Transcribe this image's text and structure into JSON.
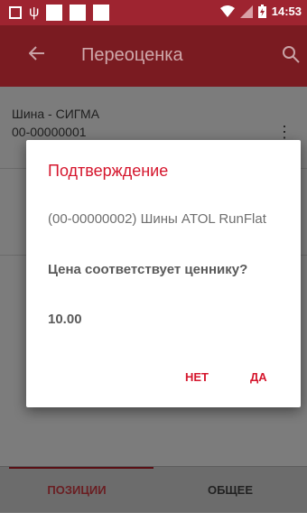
{
  "status_bar": {
    "time": "14:53"
  },
  "app_bar": {
    "title": "Переоценка"
  },
  "list": {
    "items": [
      {
        "name": "Шина - СИГМА",
        "code": "00-00000001"
      }
    ]
  },
  "bottom_nav": {
    "tab_positions": "ПОЗИЦИИ",
    "tab_general": "ОБЩЕЕ"
  },
  "dialog": {
    "title": "Подтверждение",
    "message": "(00-00000002)  Шины ATOL RunFlat",
    "question": "Цена соответствует ценнику?",
    "price": "10.00",
    "no_label": "НЕТ",
    "yes_label": "ДА"
  },
  "colors": {
    "accent": "#d5162d",
    "app_bar": "#7a1b21",
    "status_bar": "#9e2430"
  }
}
